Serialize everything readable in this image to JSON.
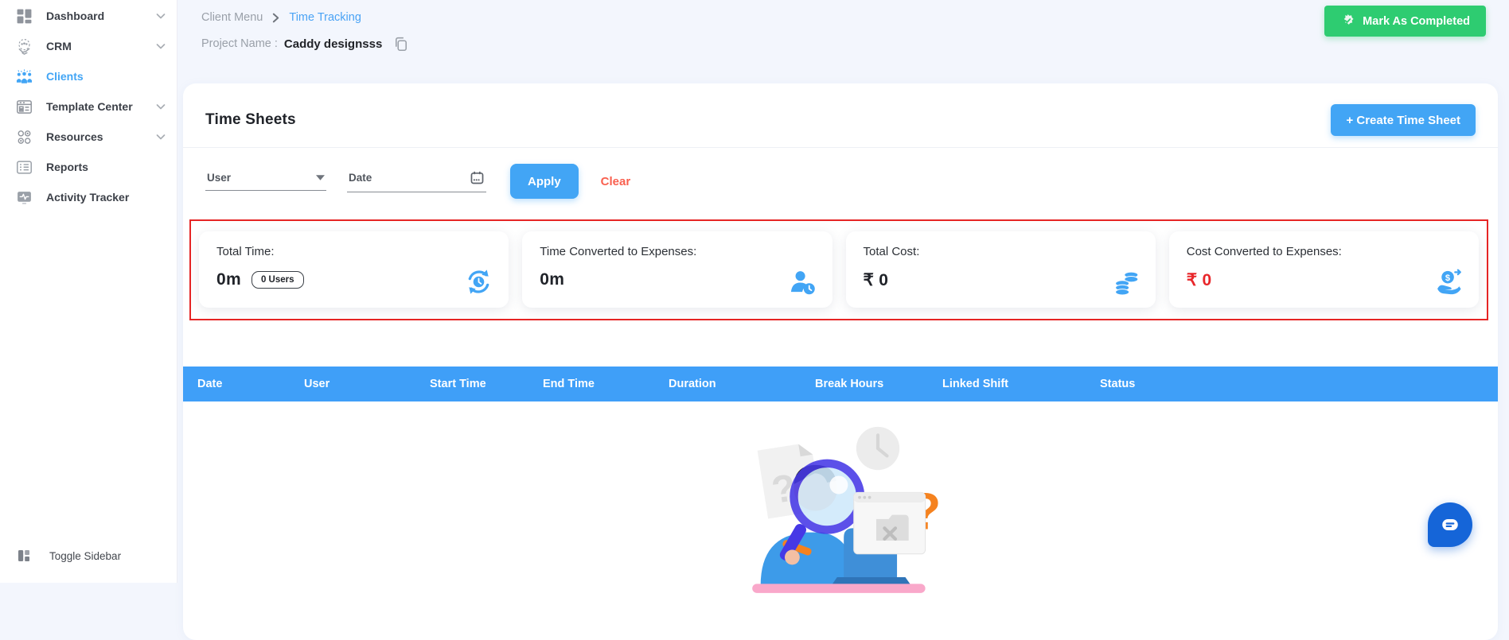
{
  "colors": {
    "accent_blue": "#42a5f5",
    "table_header_blue": "#3f9ff8",
    "success_green": "#2ecc71",
    "alert_red": "#e62525",
    "value_red": "#e8262a",
    "clear_red": "#f9604f",
    "chat_blue": "#1565d8"
  },
  "sidebar": {
    "items": [
      {
        "label": "Dashboard",
        "icon": "dashboard-icon",
        "chevron": true
      },
      {
        "label": "CRM",
        "icon": "crm-icon",
        "chevron": true
      },
      {
        "label": "Clients",
        "icon": "clients-icon",
        "chevron": false,
        "active": true
      },
      {
        "label": "Template Center",
        "icon": "template-center-icon",
        "chevron": true
      },
      {
        "label": "Resources",
        "icon": "resources-icon",
        "chevron": true
      },
      {
        "label": "Reports",
        "icon": "reports-icon",
        "chevron": false
      },
      {
        "label": "Activity Tracker",
        "icon": "activity-tracker-icon",
        "chevron": false
      }
    ],
    "toggle_label": "Toggle Sidebar"
  },
  "header": {
    "breadcrumb": {
      "parent": "Client Menu",
      "current": "Time Tracking"
    },
    "project_label": "Project Name :",
    "project_name": "Caddy designsss",
    "mark_completed_label": "Mark As Completed"
  },
  "panel": {
    "title": "Time Sheets",
    "create_button_label": "+ Create Time Sheet",
    "filters": {
      "user_label": "User",
      "date_label": "Date",
      "apply_label": "Apply",
      "clear_label": "Clear"
    },
    "stats": [
      {
        "label": "Total Time:",
        "value": "0m",
        "badge": "0 Users",
        "icon": "sync-clock-icon"
      },
      {
        "label": "Time Converted to Expenses:",
        "value": "0m",
        "icon": "user-clock-icon"
      },
      {
        "label": "Total Cost:",
        "value": "₹ 0",
        "icon": "coins-icon"
      },
      {
        "label": "Cost Converted to Expenses:",
        "value": "₹ 0",
        "icon": "hand-dollar-icon"
      }
    ],
    "table": {
      "columns": [
        "Date",
        "User",
        "Start Time",
        "End Time",
        "Duration",
        "Break Hours",
        "Linked Shift",
        "Status"
      ]
    }
  }
}
